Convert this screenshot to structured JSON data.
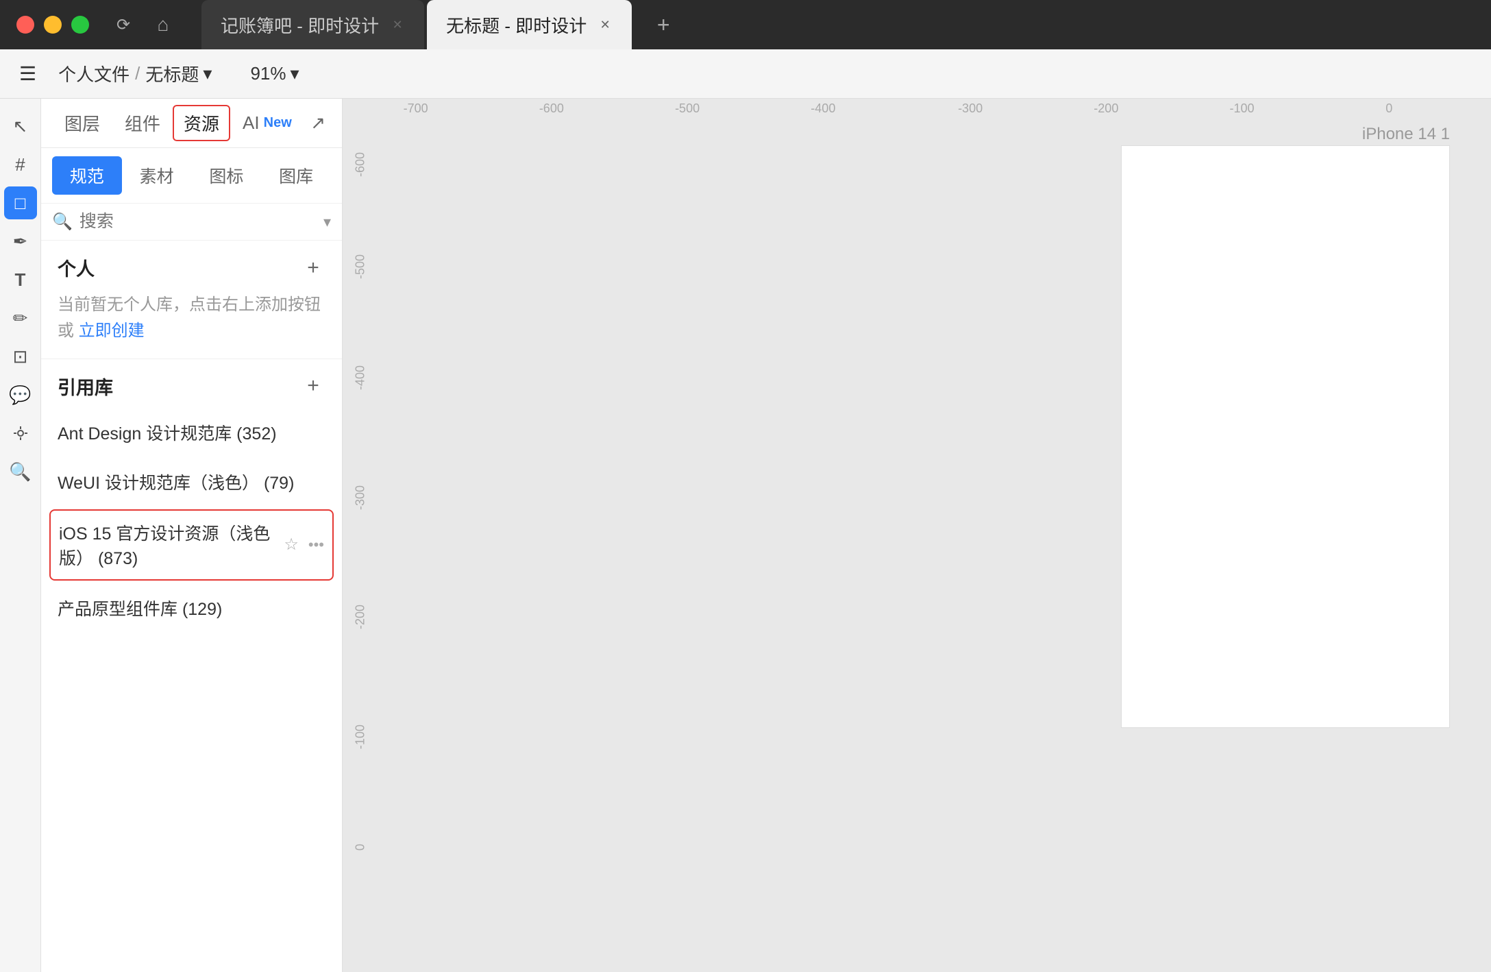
{
  "titlebar": {
    "tab1_label": "记账簿吧 - 即时设计",
    "tab2_label": "无标题 - 即时设计",
    "new_tab_label": "+"
  },
  "toolbar": {
    "menu_icon": "☰",
    "breadcrumb_personal": "个人文件",
    "breadcrumb_sep": "/",
    "breadcrumb_file": "无标题",
    "zoom_level": "91%"
  },
  "left_toolbar": {
    "icons": [
      {
        "name": "cursor-icon",
        "symbol": "↖",
        "active": false
      },
      {
        "name": "frame-icon",
        "symbol": "#",
        "active": false
      },
      {
        "name": "rectangle-icon",
        "symbol": "□",
        "active": true
      },
      {
        "name": "pen-icon",
        "symbol": "✒",
        "active": false
      },
      {
        "name": "text-icon",
        "symbol": "T",
        "active": false
      },
      {
        "name": "pencil-icon",
        "symbol": "✏",
        "active": false
      },
      {
        "name": "crop-icon",
        "symbol": "⊡",
        "active": false
      },
      {
        "name": "comment-icon",
        "symbol": "💬",
        "active": false
      },
      {
        "name": "component-icon",
        "symbol": "⊕",
        "active": false
      },
      {
        "name": "search-icon",
        "symbol": "🔍",
        "active": false
      }
    ]
  },
  "sidebar": {
    "tabs": [
      {
        "id": "layers",
        "label": "图层"
      },
      {
        "id": "components",
        "label": "组件"
      },
      {
        "id": "assets",
        "label": "资源",
        "active": true
      },
      {
        "id": "ai",
        "label": "AI",
        "badge": "New"
      },
      {
        "id": "history",
        "label": "↗"
      }
    ],
    "sub_tabs": [
      {
        "id": "spec",
        "label": "规范",
        "active": true
      },
      {
        "id": "materials",
        "label": "素材"
      },
      {
        "id": "icons",
        "label": "图标"
      },
      {
        "id": "library",
        "label": "图库"
      }
    ],
    "search_placeholder": "搜索",
    "personal_section": {
      "title": "个人",
      "add_label": "+",
      "empty_hint": "当前暂无个人库，点击右上添加按钮或",
      "empty_link": "立即创建"
    },
    "reference_section": {
      "title": "引用库",
      "add_label": "+",
      "libraries": [
        {
          "id": "ant-design",
          "name": "Ant Design 设计规范库 (352)",
          "selected": false
        },
        {
          "id": "weui",
          "name": "WeUI 设计规范库（浅色） (79)",
          "selected": false
        },
        {
          "id": "ios15",
          "name": "iOS 15 官方设计资源（浅色版） (873)",
          "selected": true
        },
        {
          "id": "prototype",
          "name": "产品原型组件库 (129)",
          "selected": false
        }
      ]
    }
  },
  "canvas": {
    "frame_label": "iPhone 14 1",
    "ruler_labels_h": [
      "-700",
      "-600",
      "-500",
      "-400",
      "-300",
      "-200",
      "-100",
      "0"
    ],
    "ruler_labels_v": [
      "-600",
      "-500",
      "-400",
      "-300",
      "-200",
      "-100",
      "0"
    ]
  }
}
